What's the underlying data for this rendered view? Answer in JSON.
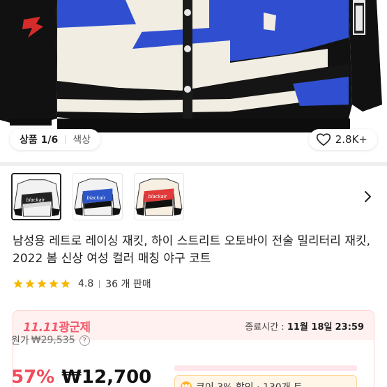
{
  "gallery": {
    "position_label": "상품 1/6",
    "color_label": "색상",
    "likes": "2.8K+",
    "thumbnail_colors": [
      "#ffffff",
      "#2d56c9",
      "#e03a3a"
    ],
    "thumbnail_logo": "blackair"
  },
  "product": {
    "title": "남성용 레트로 레이싱 재킷, 하이 스트리트 오토바이 전술 밀리터리 재킷, 2022 봄 신상 여성 컬러 매칭 야구 코트",
    "rating": "4.8",
    "rating_stars": 5,
    "sold": "36 개 판매"
  },
  "promo": {
    "badge_number": "11.11",
    "badge_text": "광군제",
    "end_label": "종료시간 :",
    "end_date": "11월 18일",
    "end_time": "23:59",
    "original_label": "원가",
    "original_price": "₩29,535",
    "discount": "57%",
    "price": "₩12,700",
    "coupon_text": "쿠이 3% 할인 · 130개 트"
  },
  "colors": {
    "accent": "#f04b5b",
    "jacket_blue": "#2f4fd0",
    "jacket_red": "#e03a3a",
    "star": "#f5b800"
  }
}
